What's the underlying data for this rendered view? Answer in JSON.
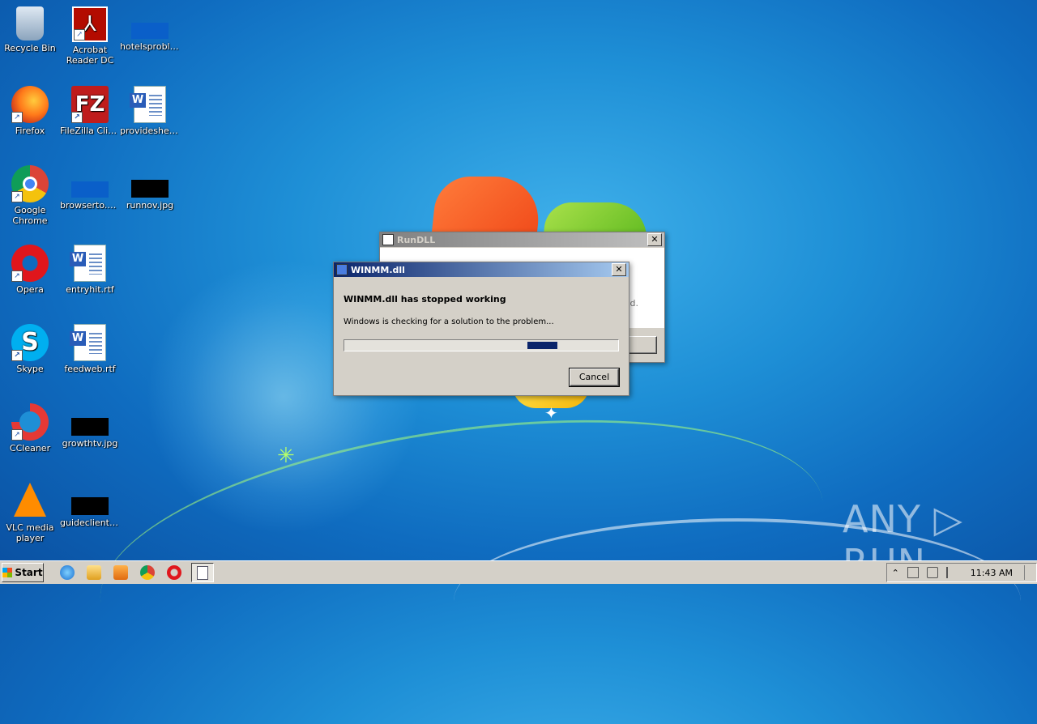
{
  "desktop": {
    "icons": [
      {
        "label": "Recycle Bin"
      },
      {
        "label": "Acrobat Reader DC"
      },
      {
        "label": "hotelsproblem..."
      },
      {
        "label": "Firefox"
      },
      {
        "label": "FileZilla Client"
      },
      {
        "label": "provideshel..."
      },
      {
        "label": "Google Chrome"
      },
      {
        "label": "browserto.png"
      },
      {
        "label": "runnov.jpg"
      },
      {
        "label": "Opera"
      },
      {
        "label": "entryhit.rtf"
      },
      {
        "label": "Skype"
      },
      {
        "label": "feedweb.rtf"
      },
      {
        "label": "CCleaner"
      },
      {
        "label": "growthtv.jpg"
      },
      {
        "label": "VLC media player"
      },
      {
        "label": "guideclient.jpg"
      }
    ],
    "glyphs": {
      "acrobat": "⅄",
      "filezilla": "FZ",
      "skype": "S",
      "word": "W",
      "shortcut": "↗"
    }
  },
  "rundll": {
    "title": "RunDLL",
    "partial_text": "d.",
    "close": "✕"
  },
  "error_dialog": {
    "title": "WINMM.dll",
    "heading": "WINMM.dll has stopped working",
    "message": "Windows is checking for a solution to the problem...",
    "progress": 0.11,
    "cancel_label": "Cancel",
    "close": "✕"
  },
  "taskbar": {
    "start_label": "Start",
    "clock": "11:43 AM",
    "tray_up": "⌃"
  },
  "watermark": "ANY ▷ RUN",
  "colors": {
    "title_active": "#0a246a",
    "progress_fill": "#0a246a",
    "taskbar": "#d4d0c8"
  }
}
